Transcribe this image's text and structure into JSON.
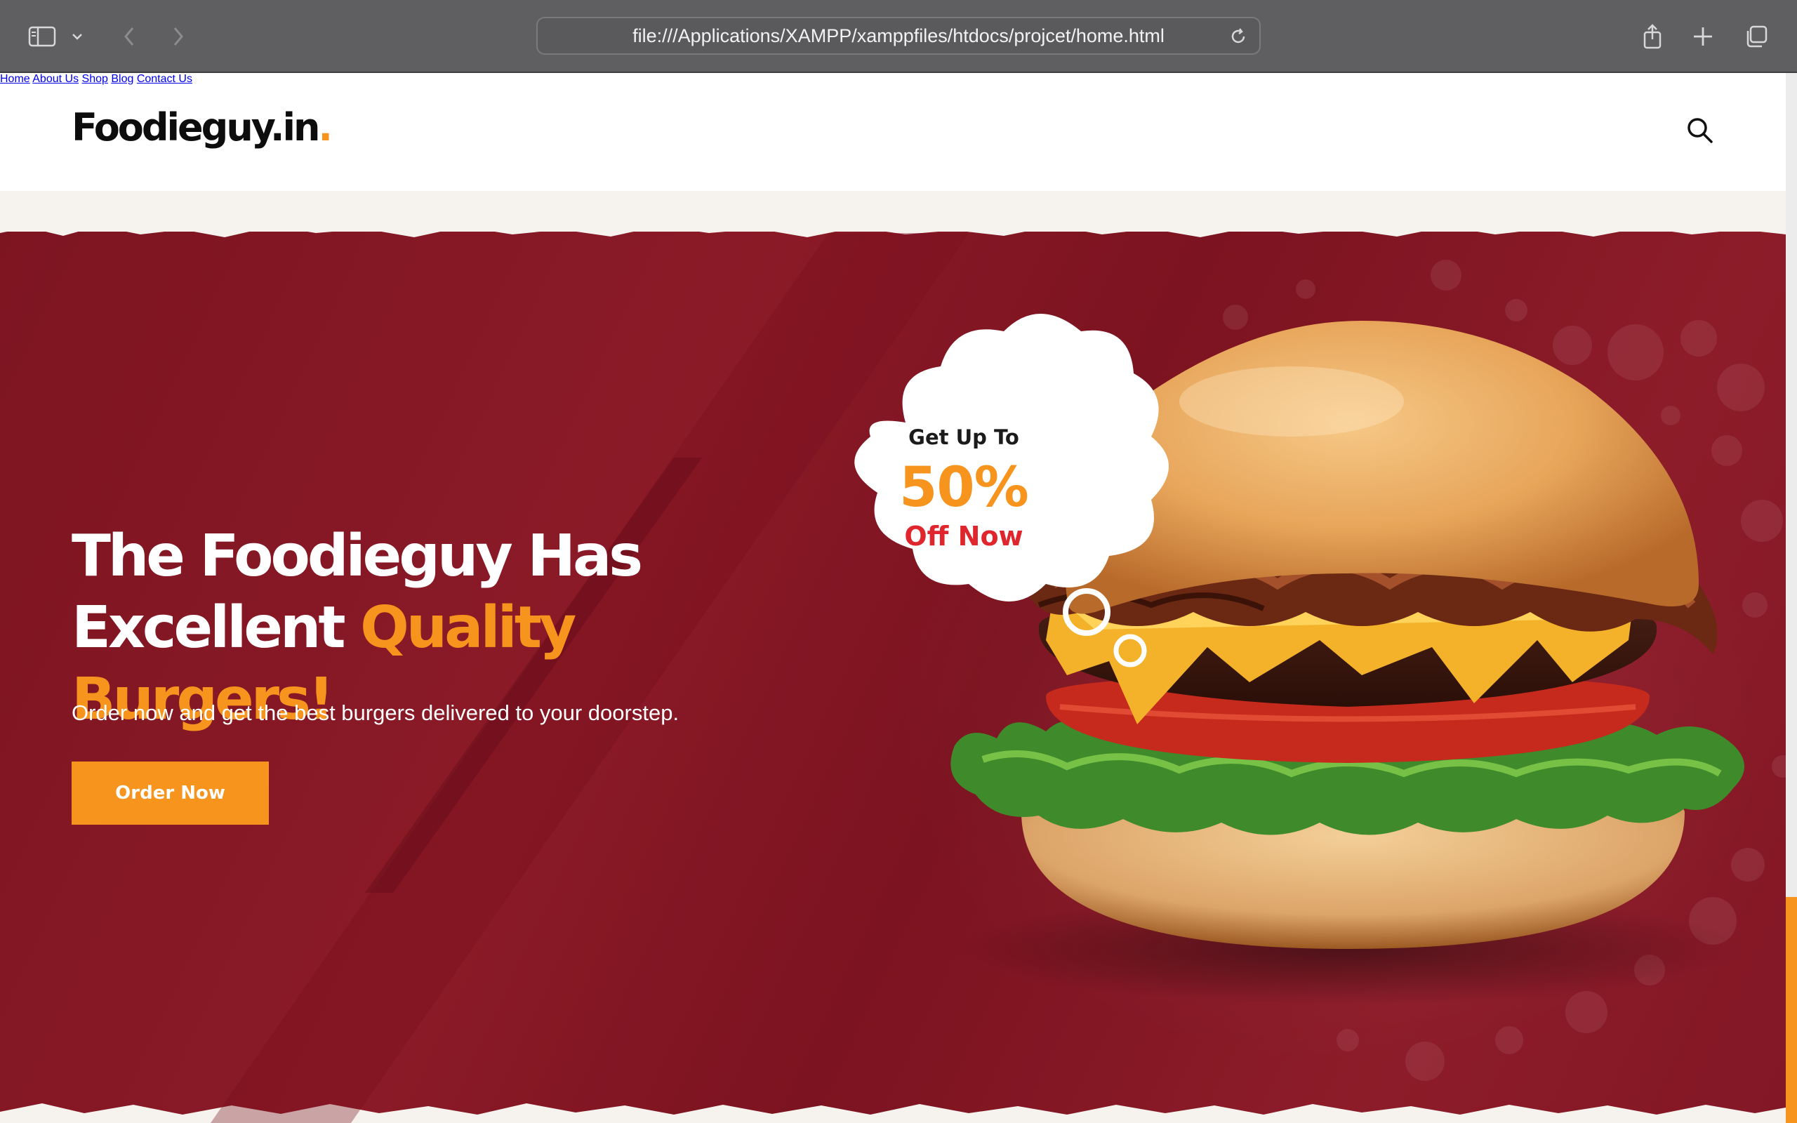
{
  "browser": {
    "url": "file:///Applications/XAMPP/xamppfiles/htdocs/projcet/home.html",
    "icons": [
      "sidebar-icon",
      "chevron-down-icon",
      "back-icon",
      "forward-icon",
      "reload-icon",
      "share-icon",
      "new-tab-icon",
      "tabs-overview-icon"
    ]
  },
  "site": {
    "logo_text": "Foodieguy.in",
    "logo_dot": "."
  },
  "nav": {
    "items": [
      "Home",
      "About Us",
      "Shop",
      "Blog",
      "Contact Us"
    ],
    "search_icon": "search-icon"
  },
  "hero": {
    "headline_line1": "The Foodieguy Has",
    "headline_line2_plain": "Excellent ",
    "headline_line2_accent": "Quality Burgers!",
    "subtitle": "Order now and get the best burgers delivered to your doorstep.",
    "cta_label": "Order Now",
    "promo": {
      "line1": "Get Up To",
      "percent": "50%",
      "line3": "Off Now"
    }
  },
  "colors": {
    "accent": "#f7941d",
    "hero_bg": "#8b1a27",
    "promo_red": "#e0262d",
    "chrome": "#5f5f62"
  }
}
